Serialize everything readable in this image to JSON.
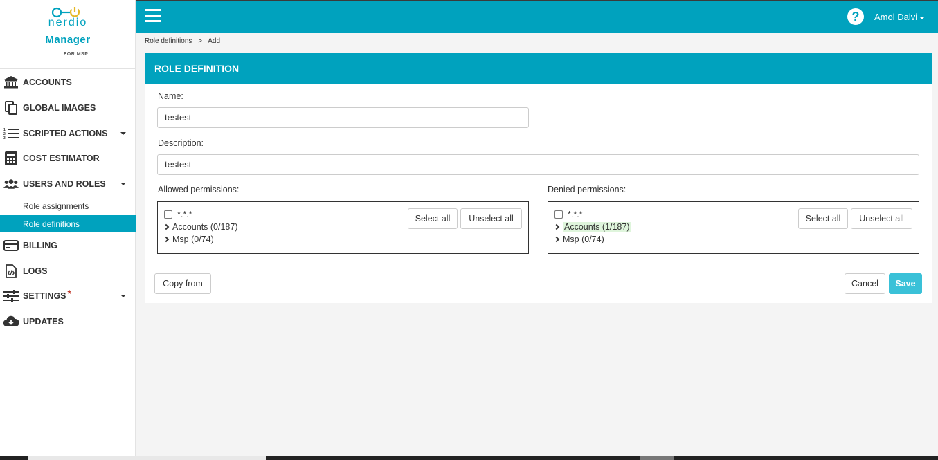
{
  "brand": {
    "name": "nerdio",
    "product": "Manager",
    "suffix": "for MSP",
    "accent": "#00a2be"
  },
  "topbar": {
    "user_name": "Amol Dalvi",
    "help_icon": "question-circle-icon",
    "menu_icon": "hamburger-icon"
  },
  "nav": {
    "items": [
      {
        "label": "ACCOUNTS",
        "icon": "bank-icon"
      },
      {
        "label": "GLOBAL IMAGES",
        "icon": "copy-icon"
      },
      {
        "label": "SCRIPTED ACTIONS",
        "icon": "numbered-list-icon"
      },
      {
        "label": "COST ESTIMATOR",
        "icon": "calculator-icon"
      },
      {
        "label": "USERS AND ROLES",
        "icon": "users-icon"
      },
      {
        "label": "BILLING",
        "icon": "credit-card-icon"
      },
      {
        "label": "LOGS",
        "icon": "code-file-icon"
      },
      {
        "label": "SETTINGS",
        "icon": "sliders-icon",
        "badge": "*"
      },
      {
        "label": "UPDATES",
        "icon": "cloud-download-icon"
      }
    ],
    "sub_items": [
      {
        "label": "Role assignments"
      },
      {
        "label": "Role definitions",
        "active": true
      }
    ]
  },
  "breadcrumb": {
    "parent": "Role definitions",
    "separator": ">",
    "current": "Add"
  },
  "card": {
    "title": "ROLE DEFINITION",
    "name_label": "Name:",
    "name_value": "testest",
    "description_label": "Description:",
    "description_value": "testest",
    "allowed": {
      "label": "Allowed permissions:",
      "root": "*.*.*",
      "groups": [
        "Accounts (0/187)",
        "Msp (0/74)"
      ],
      "select_all": "Select all",
      "unselect_all": "Unselect all"
    },
    "denied": {
      "label": "Denied permissions:",
      "root": "*.*.*",
      "groups": [
        "Accounts (1/187)",
        "Msp (0/74)"
      ],
      "select_all": "Select all",
      "unselect_all": "Unselect all"
    },
    "copy_from": "Copy from",
    "cancel": "Cancel",
    "save": "Save"
  }
}
